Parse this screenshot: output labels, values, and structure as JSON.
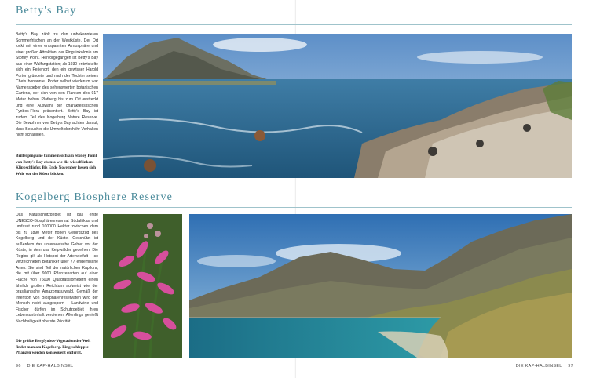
{
  "section1": {
    "heading": "Betty's Bay",
    "body": "Betty's Bay zählt zu den unbekannteren Sommerfrischen an der Westküste. Der Ort lockt mit einer entspannten Atmosphäre und einer großen Attraktion: der Pinguinkolonie am Stoney Point. Hervorgegangen ist Betty's Bay aus einer Walfangstation; ab 1930 entwickelte sich ein Ferienort, den ein gewisser Harold Porter gründete und nach der Tochter seines Chefs benannte. Porter selbst wiederum war Namensgeber des sehenswerten botanischen Gartens, der sich von den Flanken des 917 Meter hohen Platberg bis zum Ort erstreckt und eine Auswahl der charakteristischen Fynbos-Flora präsentiert. Betty's Bay ist zudem Teil des Kogelberg Nature Reserve. Die Bewohner von Betty's Bay achten darauf, dass Besucher die Umwelt durch ihr Verhalten nicht schädigen.",
    "caption": "Brillenpinguine tummeln sich am Stoney Point von Betty's Bay ebenso wie die wieselflinken Klippschliefer. Bis Ende November lassen sich Wale vor der Küste blicken."
  },
  "section2": {
    "heading": "Kogelberg Biosphere Reserve",
    "body": "Das Naturschutzgebiet ist das erste UNESCO-Biosphärenreservat Südafrikas und umfasst rund 100000 Hektar zwischen dem bis zu 1890 Meter hohen Gebirgszug des Kogelberg und der Küste. Geschützt ist außerdem das unterseeische Gebiet vor der Küste, in dem u.a. Kelpwälder gedeihen. Die Region gilt als Hotspot der Artenvielfalt – so verzeichneten Botaniker über 77 endemische Arten. Sie sind Teil der natürlichen Kapflora, die mit über 9000 Pflanzenarten auf einer Fläche von 76000 Quadratkilometern einen ähnlich großen Reichtum aufweist wie der brasilianische Amazonasurwald. Gemäß der Intention von Biosphärenreservaten wird der Mensch nicht ausgesperrt – Landwirte und Fischer dürfen im Schutzgebiet ihren Lebensunterhalt verdienen. Allerdings genießt Nachhaltigkeit oberste Priorität.",
    "caption": "Die größte Bergfynbos-Vegetation der Welt findet man am Kogelberg. Eingeschleppte Pflanzen werden konsequent entfernt."
  },
  "footer": {
    "left_page_number": "96",
    "left_running_title": "DIE KAP-HALBINSEL",
    "right_running_title": "DIE KAP-HALBINSEL",
    "right_page_number": "97"
  },
  "colors": {
    "heading_accent": "#4a8a9a",
    "rule": "#9fc3cb"
  }
}
